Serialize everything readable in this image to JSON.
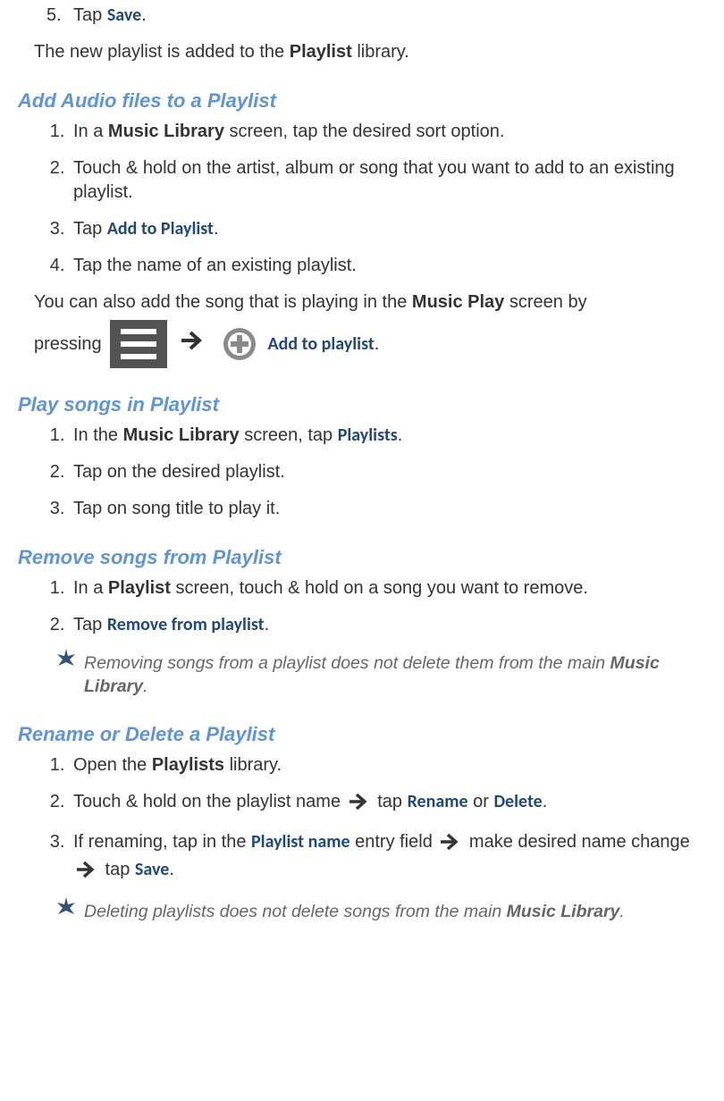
{
  "prev": {
    "step5_pre": "Tap ",
    "step5_link": "Save",
    "step5_post": ".",
    "after_pre": "The new playlist is added to the ",
    "after_bold": "Playlist",
    "after_post": " library."
  },
  "addAudio": {
    "heading": "Add Audio files to a Playlist",
    "s1_pre": "In a ",
    "s1_bold": "Music Library",
    "s1_post": " screen, tap the desired sort option.",
    "s2": "Touch & hold on the artist, album or song that you want to add to an existing playlist.",
    "s3_pre": "Tap ",
    "s3_link": "Add to Playlist",
    "s3_post": ".",
    "s4": "Tap the name of an existing playlist.",
    "para_pre": "You can also add the song that is playing in the ",
    "para_bold": "Music Play",
    "para_post": " screen by",
    "line_pre": "pressing ",
    "line_link": "Add to playlist",
    "line_post": "."
  },
  "play": {
    "heading": "Play songs in Playlist",
    "s1_pre": "In the ",
    "s1_bold": "Music Library",
    "s1_mid": " screen, tap ",
    "s1_link": "Playlists",
    "s1_post": ".",
    "s2": "Tap on the desired playlist.",
    "s3": "Tap on song title to play it."
  },
  "remove": {
    "heading": "Remove songs from Playlist",
    "s1_pre": "In a ",
    "s1_bold": "Playlist",
    "s1_post": " screen, touch & hold on a song you want to remove.",
    "s2_pre": "Tap ",
    "s2_link": "Remove from playlist",
    "s2_post": ".",
    "note_pre": " Removing songs from a playlist does not delete them from the main ",
    "note_bold": "Music Library",
    "note_post": "."
  },
  "rename": {
    "heading": "Rename or Delete a Playlist",
    "s1_pre": "Open the ",
    "s1_bold": "Playlists",
    "s1_post": " library.",
    "s2_pre": "Touch & hold on the playlist name ",
    "s2_mid": " tap ",
    "s2_link1": "Rename",
    "s2_or": " or ",
    "s2_link2": "Delete",
    "s2_post": ".",
    "s3_pre": "If renaming, tap in the ",
    "s3_link1": "Playlist name",
    "s3_mid1": " entry field ",
    "s3_mid2": " make desired name change ",
    "s3_mid3": " tap ",
    "s3_link2": "Save",
    "s3_post": ".",
    "note_pre": " Deleting playlists does not delete songs from the main ",
    "note_bold": "Music Library",
    "note_post": "."
  }
}
